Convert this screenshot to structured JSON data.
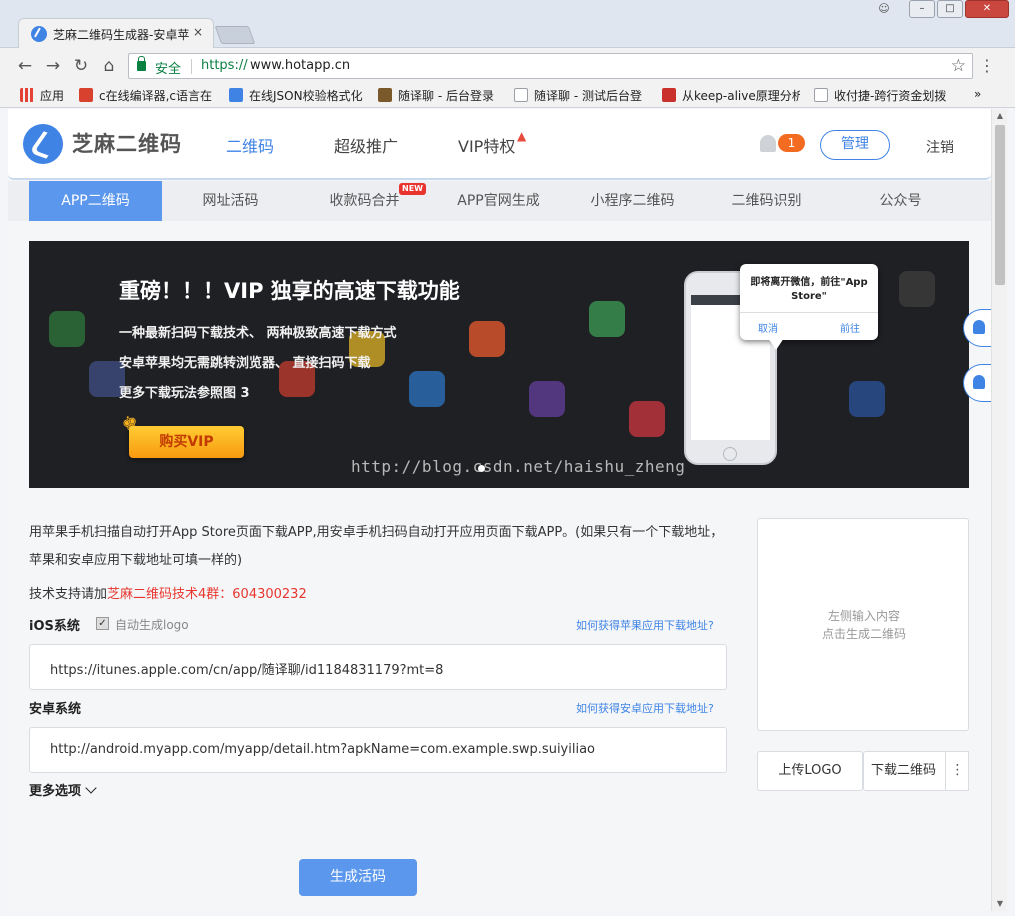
{
  "browser": {
    "tab_title": "芝麻二维码生成器-安卓苹",
    "tab_close": "×",
    "secure_label": "安全",
    "url_scheme": "https://",
    "url_host": "www.hotapp.cn"
  },
  "bookmarks": [
    {
      "label": "应用",
      "icon_color": "#e34234"
    },
    {
      "label": "c在线编译器,c语言在",
      "icon_color": "#d9412f"
    },
    {
      "label": "在线JSON校验格式化",
      "icon_color": "#3f84e5"
    },
    {
      "label": "随译聊 - 后台登录",
      "icon_color": "#7a5a2b"
    },
    {
      "label": "随译聊 - 测试后台登",
      "icon_color": "#9aa0a6"
    },
    {
      "label": "从keep-alive原理分析",
      "icon_color": "#c9302c"
    },
    {
      "label": "收付捷-跨行资金划拨",
      "icon_color": "#9aa0a6"
    }
  ],
  "bookmarks_overflow": "»",
  "header": {
    "logo_text": "芝麻二维码",
    "nav": [
      {
        "label": "二维码",
        "active": true
      },
      {
        "label": "超级推广",
        "active": false
      },
      {
        "label": "VIP特权",
        "active": false
      }
    ],
    "notification_count": "1",
    "manage_label": "管理",
    "logout_label": "注销"
  },
  "subnav": {
    "tabs": [
      "APP二维码",
      "网址活码",
      "收款码合并",
      "APP官网生成",
      "小程序二维码",
      "二维码识别",
      "公众号"
    ],
    "new_badge": "NEW"
  },
  "banner": {
    "title": "重磅！！！VIP 独享的高速下载功能",
    "lines": [
      "一种最新扫码下载技术、 两种极致高速下载方式",
      "安卓苹果均无需跳转浏览器、 直接扫码下载",
      "更多下载玩法参照图 3"
    ],
    "vip_button": "购买VIP",
    "dialog_text": "即将离开微信，前往\"App Store\"",
    "dialog_cancel": "取消",
    "dialog_confirm": "前往",
    "watermark": "http://blog.csdn.net/haishu_zheng"
  },
  "form": {
    "description": "用苹果手机扫描自动打开App Store页面下载APP,用安卓手机扫码自动打开应用页面下载APP。(如果只有一个下载地址，苹果和安卓应用下载地址可填一样的)",
    "support_prefix": "技术支持请加",
    "support_group": "芝麻二维码技术4群：604300232",
    "ios_label": "iOS系统",
    "auto_logo": "自动生成logo",
    "ios_help": "如何获得苹果应用下载地址?",
    "ios_value": "https://itunes.apple.com/cn/app/随译聊/id1184831179?mt=8",
    "android_label": "安卓系统",
    "android_help": "如何获得安卓应用下载地址?",
    "android_value": "http://android.myapp.com/myapp/detail.htm?apkName=com.example.swp.suiyiliao",
    "more_options": "更多选项",
    "generate_button": "生成活码"
  },
  "qr_panel": {
    "hint_line1": "左侧输入内容",
    "hint_line2": "点击生成二维码",
    "upload_logo": "上传LOGO",
    "download_qr": "下载二维码"
  }
}
